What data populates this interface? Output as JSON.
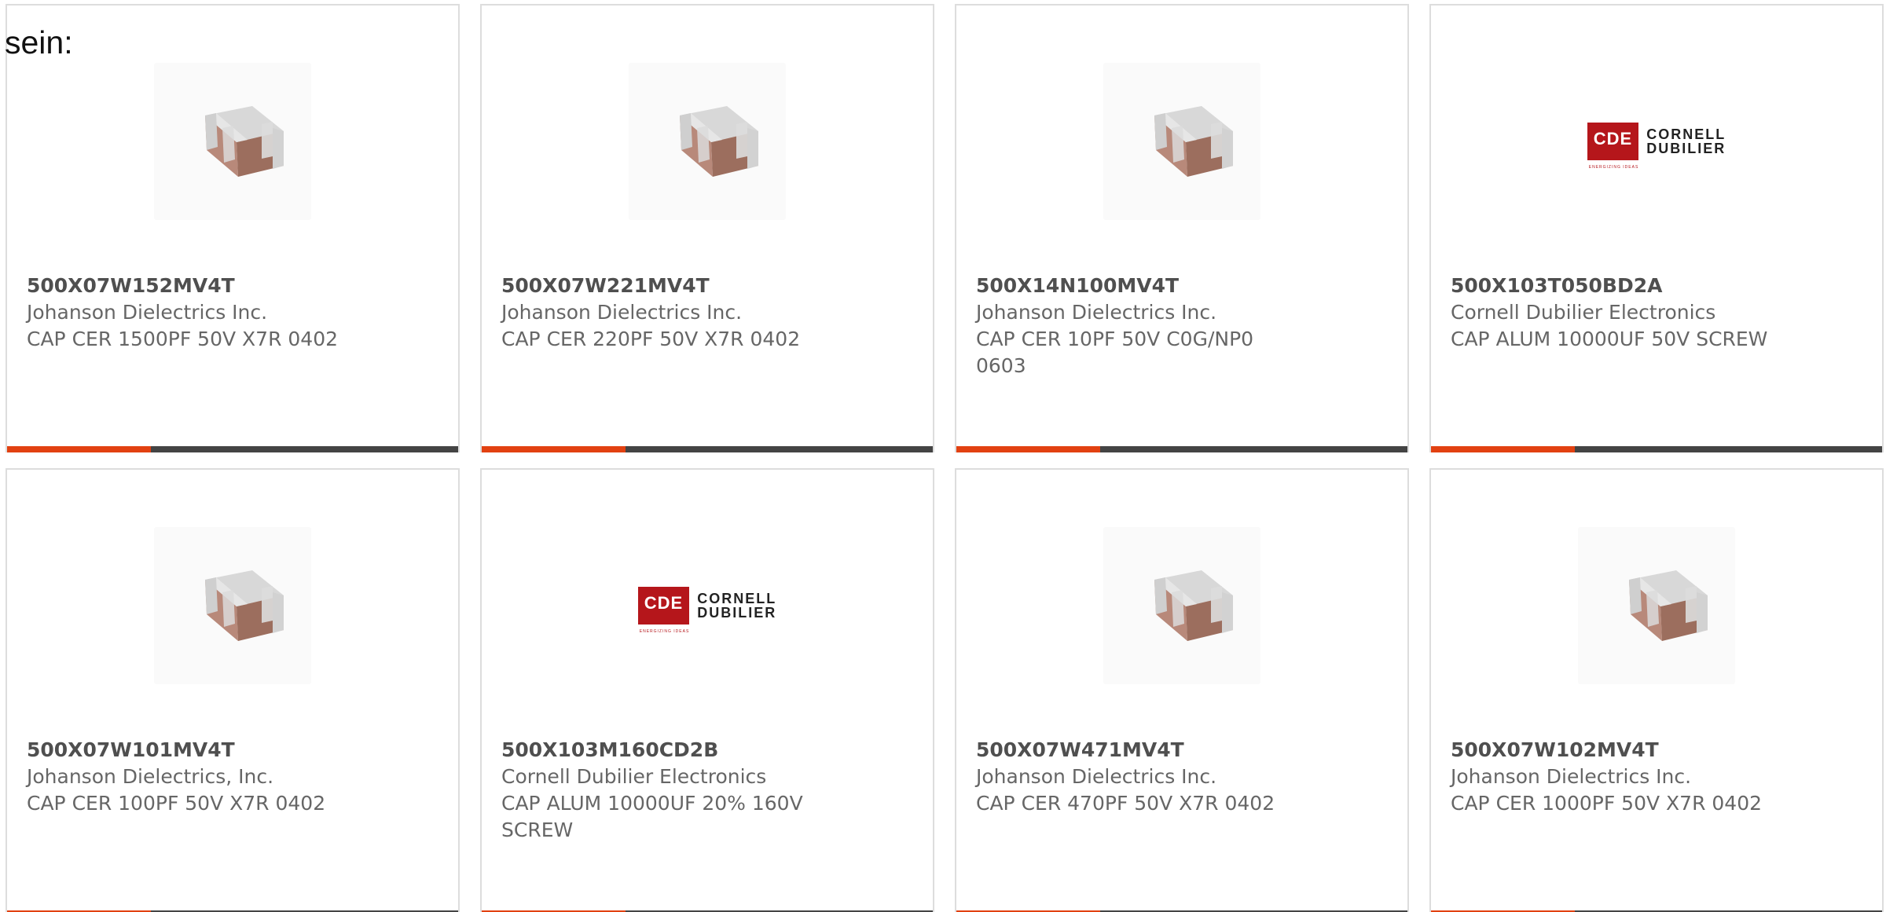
{
  "intro_text": "sein:",
  "colors": {
    "accent_bar": "#e24111",
    "bar": "#444444",
    "border": "#dddddd",
    "text": "#666666",
    "part_number": "#4f4f4f",
    "cde_red": "#b5161b"
  },
  "cards": [
    {
      "part_number": "500X07W152MV4T",
      "manufacturer": "Johanson Dielectrics Inc.",
      "description": "CAP CER 1500PF 50V X7R 0402",
      "image": "ceramic-capacitor-icon"
    },
    {
      "part_number": "500X07W221MV4T",
      "manufacturer": "Johanson Dielectrics Inc.",
      "description": "CAP CER 220PF 50V X7R 0402",
      "image": "ceramic-capacitor-icon"
    },
    {
      "part_number": "500X14N100MV4T",
      "manufacturer": "Johanson Dielectrics Inc.",
      "description": "CAP CER 10PF 50V C0G/NP0 0603",
      "image": "ceramic-capacitor-icon"
    },
    {
      "part_number": "500X103T050BD2A",
      "manufacturer": "Cornell Dubilier Electronics",
      "description": "CAP ALUM 10000UF 50V SCREW",
      "image": "cde-logo"
    },
    {
      "part_number": "500X07W101MV4T",
      "manufacturer": "Johanson Dielectrics, Inc.",
      "description": "CAP CER 100PF 50V X7R 0402",
      "image": "ceramic-capacitor-icon"
    },
    {
      "part_number": "500X103M160CD2B",
      "manufacturer": "Cornell Dubilier Electronics",
      "description": "CAP ALUM 10000UF 20% 160V SCREW",
      "image": "cde-logo"
    },
    {
      "part_number": "500X07W471MV4T",
      "manufacturer": "Johanson Dielectrics Inc.",
      "description": "CAP CER 470PF 50V X7R 0402",
      "image": "ceramic-capacitor-icon"
    },
    {
      "part_number": "500X07W102MV4T",
      "manufacturer": "Johanson Dielectrics Inc.",
      "description": "CAP CER 1000PF 50V X7R 0402",
      "image": "ceramic-capacitor-icon"
    }
  ],
  "logo": {
    "badge": "CDE",
    "line1": "CORNELL",
    "line2": "DUBILIER",
    "tagline": "ENERGIZING IDEAS"
  }
}
